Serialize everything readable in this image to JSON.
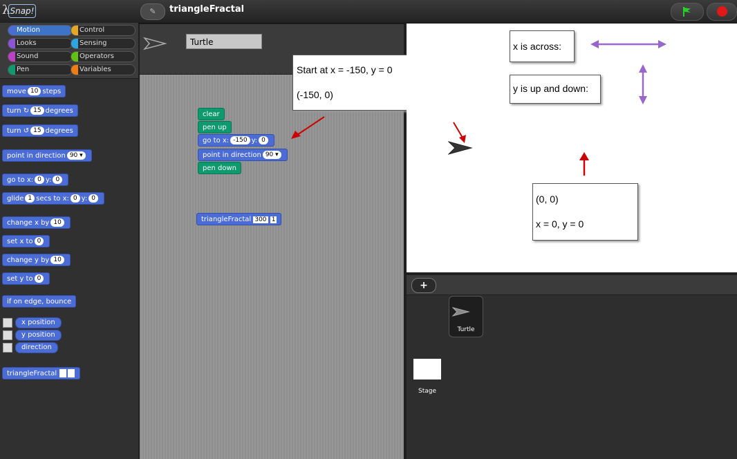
{
  "app": {
    "logo_text": "Snap!",
    "logo_symbol": "λ"
  },
  "project": {
    "title": "triangleFractal",
    "edit_icon": "pencil-icon"
  },
  "controls": {
    "start_icon": "green-flag-icon",
    "stop_icon": "stop-sign-icon"
  },
  "categories": [
    {
      "label": "Motion",
      "color": "#4a6cd4",
      "selected": true
    },
    {
      "label": "Control",
      "color": "#e6a822"
    },
    {
      "label": "Looks",
      "color": "#8a55d7"
    },
    {
      "label": "Sensing",
      "color": "#2ca5e2"
    },
    {
      "label": "Sound",
      "color": "#bb42c3"
    },
    {
      "label": "Operators",
      "color": "#62c213"
    },
    {
      "label": "Pen",
      "color": "#0e9a6c"
    },
    {
      "label": "Variables",
      "color": "#ee7d16"
    }
  ],
  "palette": {
    "move": {
      "a": "move",
      "v": "10",
      "b": "steps"
    },
    "turn_cw": {
      "a": "turn ↻",
      "v": "15",
      "b": "degrees"
    },
    "turn_ccw": {
      "a": "turn ↺",
      "v": "15",
      "b": "degrees"
    },
    "point_dir": {
      "a": "point in direction",
      "v": "90 ▾"
    },
    "goto": {
      "a": "go to x:",
      "x": "0",
      "m": "y:",
      "y": "0"
    },
    "glide": {
      "a": "glide",
      "s": "1",
      "m": "secs to x:",
      "x": "0",
      "n": "y:",
      "y": "0"
    },
    "change_x": {
      "a": "change x by",
      "v": "10"
    },
    "set_x": {
      "a": "set x to",
      "v": "0"
    },
    "change_y": {
      "a": "change y by",
      "v": "10"
    },
    "set_y": {
      "a": "set y to",
      "v": "0"
    },
    "bounce": "if on edge, bounce",
    "reporters": [
      "x position",
      "y position",
      "direction"
    ],
    "custom": "triangleFractal"
  },
  "sprite": {
    "name": "Turtle"
  },
  "script": {
    "clear": "clear",
    "pen_up": "pen up",
    "goto": {
      "a": "go to x:",
      "x": "-150",
      "m": "y:",
      "y": "0"
    },
    "point_dir": {
      "a": "point in direction",
      "v": "90 ▾"
    },
    "pen_down": "pen down",
    "call": {
      "a": "triangleFractal",
      "p1": "300",
      "p2": "1"
    }
  },
  "annotations": {
    "start_line1": "Start at x = -150, y = 0",
    "start_line2": "(-150, 0)",
    "x_across": "x is across:",
    "y_updown": "y is up and down:",
    "origin_line1": "(0, 0)",
    "origin_line2": "x = 0, y = 0"
  },
  "colors": {
    "arrow_red": "#cc0000",
    "arrow_purple": "#9966cc"
  },
  "corral": {
    "add_label": "+",
    "sprites": [
      {
        "name": "Turtle"
      }
    ],
    "stage_label": "Stage"
  }
}
